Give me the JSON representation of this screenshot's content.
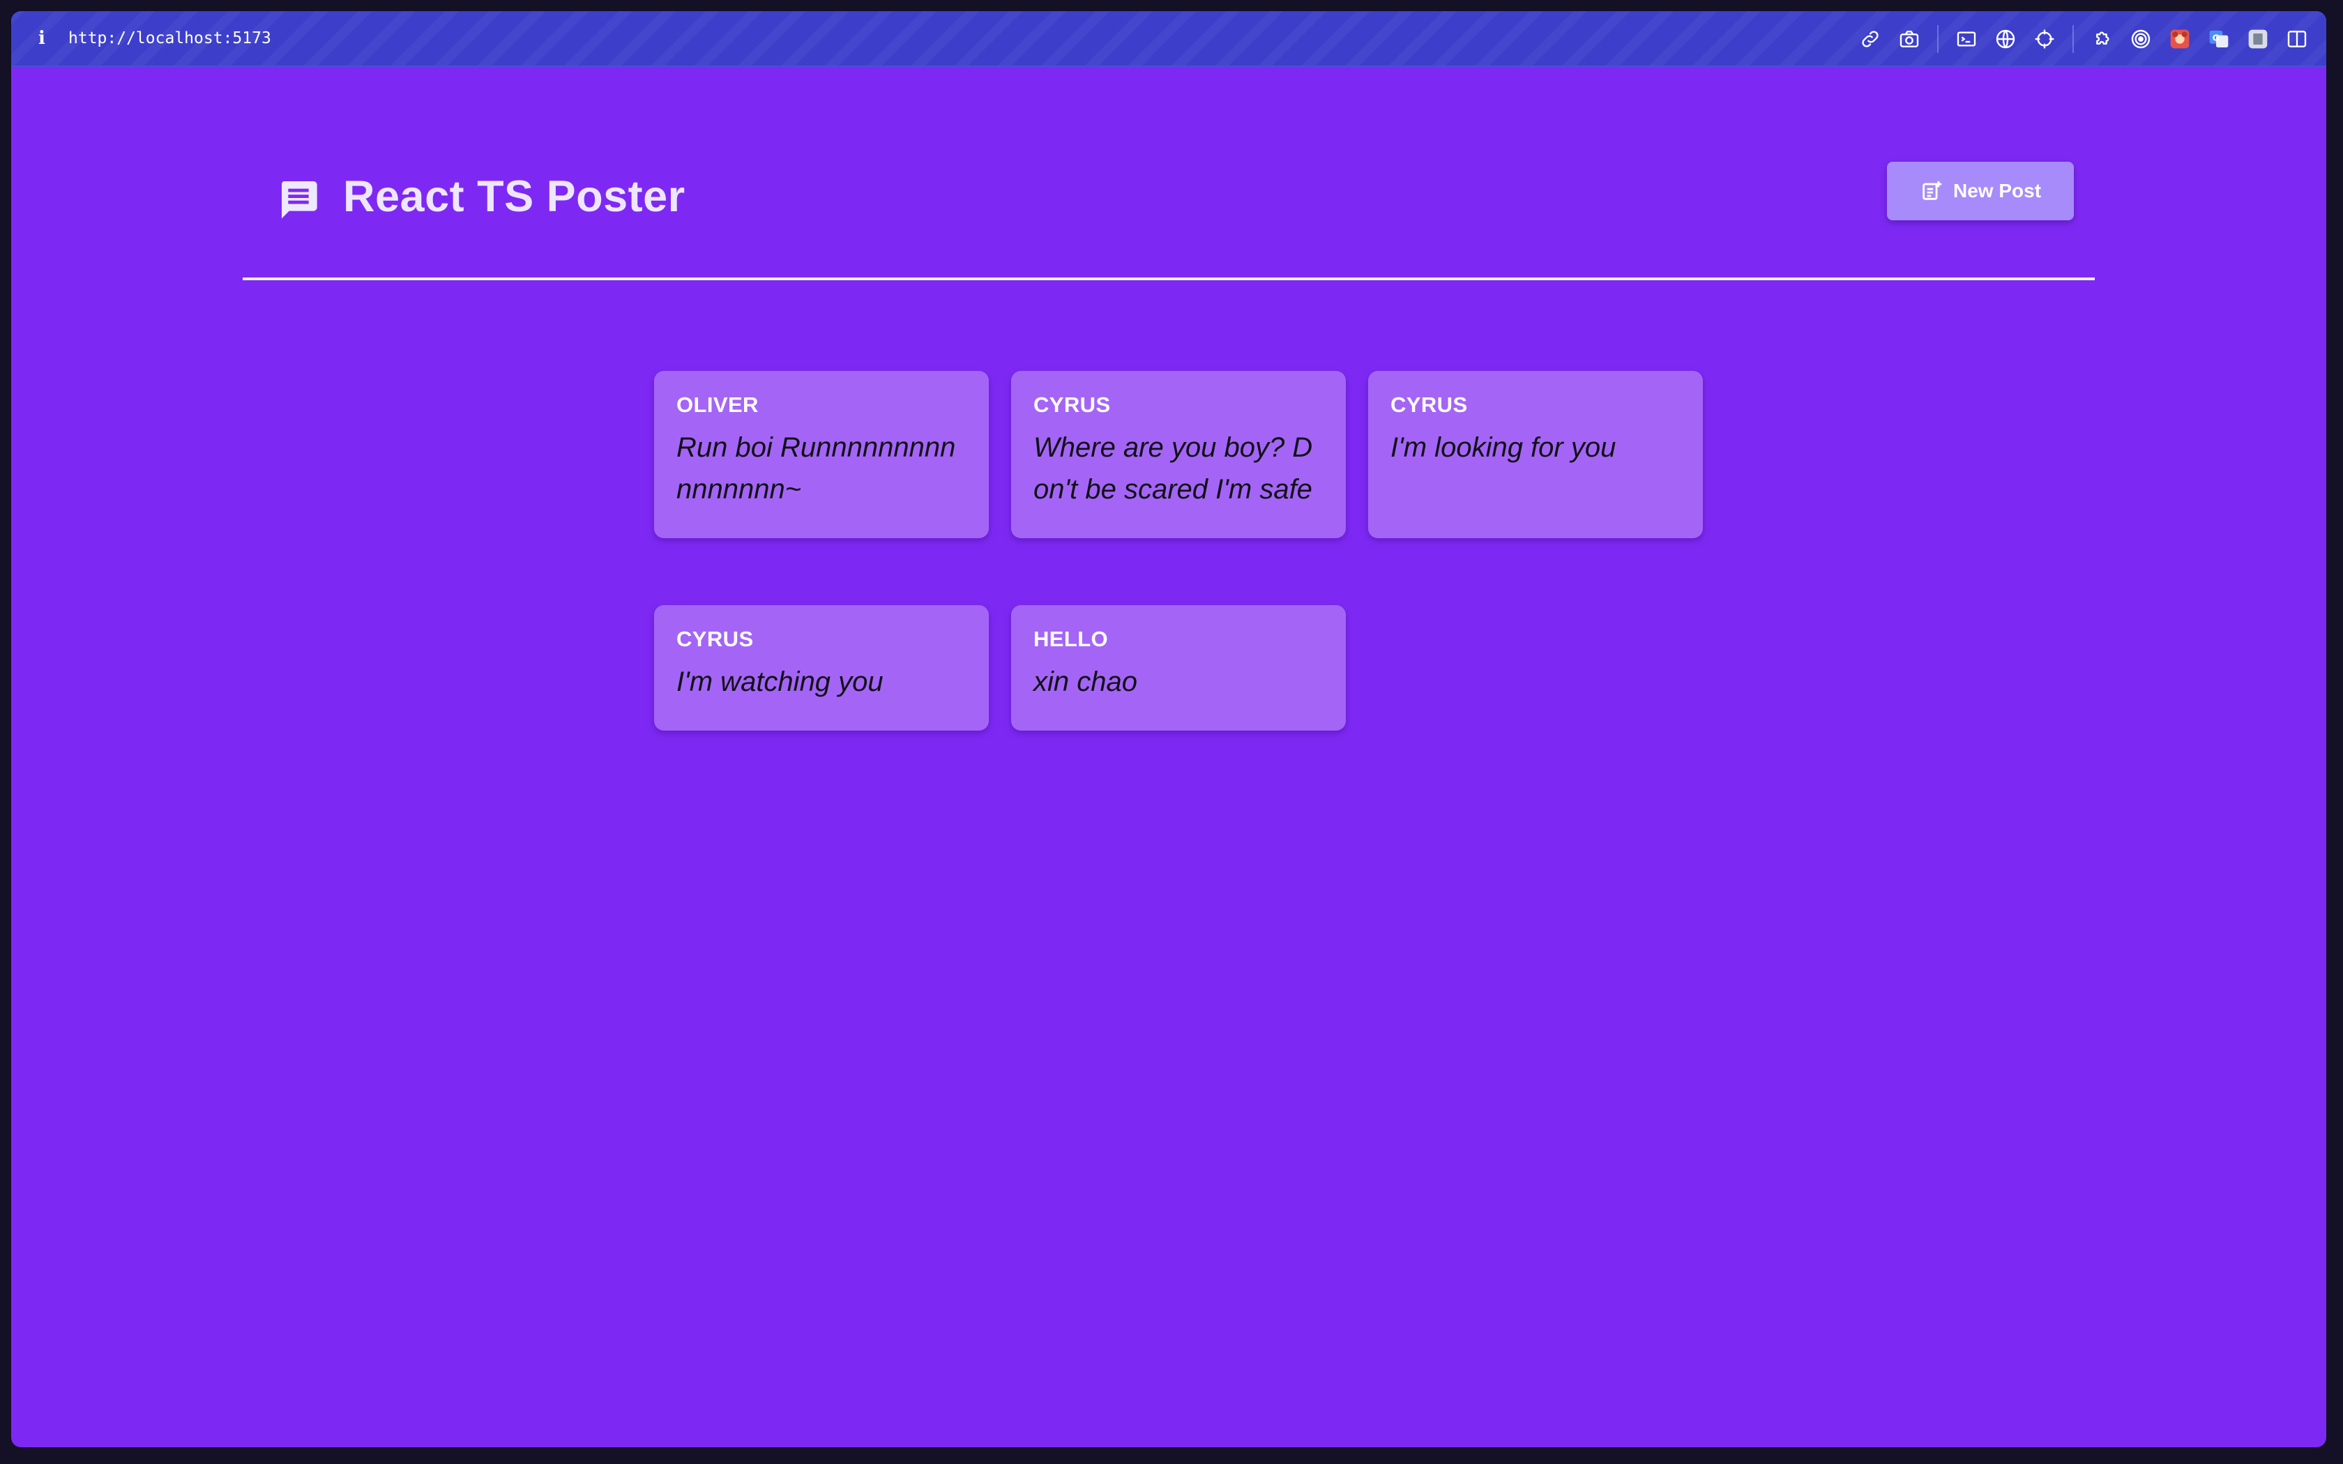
{
  "browser": {
    "info_label": "i",
    "url": "http://localhost:5173"
  },
  "header": {
    "title": "React TS Poster",
    "new_post_label": "New Post"
  },
  "posts": [
    {
      "author": "OLIVER",
      "body": "Run boi Runnnnnnnnnnnnnnnn~"
    },
    {
      "author": "CYRUS",
      "body": "Where are you boy? Don't be scared I'm safe"
    },
    {
      "author": "CYRUS",
      "body": "I'm looking for you"
    },
    {
      "author": "CYRUS",
      "body": "I'm watching you"
    },
    {
      "author": "HELLO",
      "body": "xin chao"
    }
  ],
  "colors": {
    "page_background": "#7e29f3",
    "toolbar_background": "#3d3fcb",
    "card_background": "#a465f6",
    "button_background": "#a78bfa"
  }
}
